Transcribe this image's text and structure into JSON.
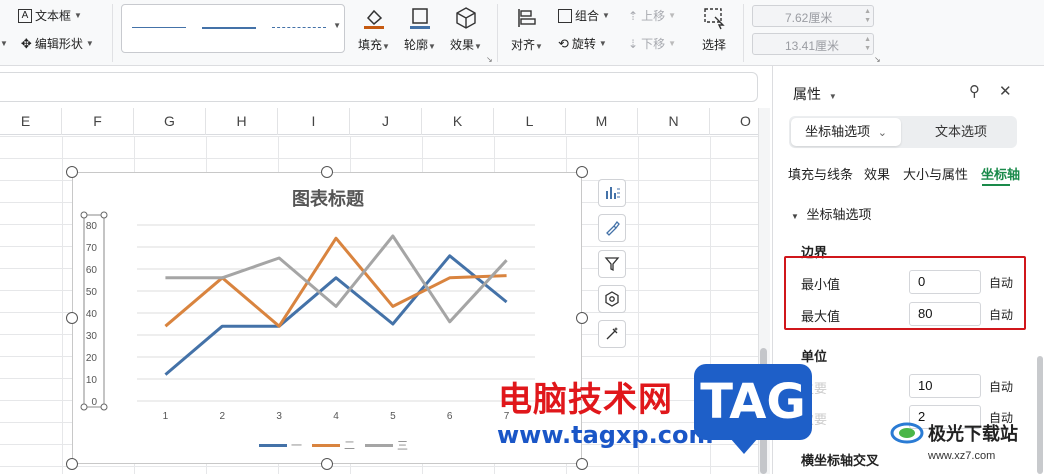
{
  "ribbon": {
    "textbox_label": "文本框",
    "edit_shape_label": "编辑形状",
    "fill_label": "填充",
    "outline_label": "轮廓",
    "effect_label": "效果",
    "align_label": "对齐",
    "group_label": "组合",
    "rotate_label": "旋转",
    "move_up_label": "上移",
    "move_down_label": "下移",
    "select_label": "选择",
    "width_value": "7.62厘米",
    "height_value": "13.41厘米"
  },
  "columns": [
    "E",
    "F",
    "G",
    "H",
    "I",
    "J",
    "K",
    "L",
    "M",
    "N",
    "O"
  ],
  "chart_data": {
    "type": "line",
    "title": "图表标题",
    "categories": [
      "1",
      "2",
      "3",
      "4",
      "5",
      "6",
      "7"
    ],
    "y_ticks": [
      "0",
      "10",
      "20",
      "30",
      "40",
      "50",
      "60",
      "70",
      "80"
    ],
    "ylim": [
      0,
      80
    ],
    "legend_position": "bottom",
    "grid": true,
    "series": [
      {
        "name": "一",
        "color": "#4472a8",
        "values": [
          12,
          34,
          34,
          56,
          35,
          66,
          45
        ]
      },
      {
        "name": "二",
        "color": "#d9843f",
        "values": [
          34,
          56,
          34,
          74,
          43,
          56,
          57
        ]
      },
      {
        "name": "三",
        "color": "#a5a5a5",
        "values": [
          56,
          56,
          65,
          43,
          75,
          36,
          64
        ]
      }
    ]
  },
  "panel": {
    "title": "属性",
    "seg_axis_options": "坐标轴选项",
    "seg_text_options": "文本选项",
    "tabs": [
      "填充与线条",
      "效果",
      "大小与属性",
      "坐标轴"
    ],
    "section_title": "坐标轴选项",
    "bounds_title": "边界",
    "min_label": "最小值",
    "min_value": "0",
    "max_label": "最大值",
    "max_value": "80",
    "auto_label": "自动",
    "units_title": "单位",
    "major_label": "主要",
    "major_value": "10",
    "minor_label": "次要",
    "minor_value": "2",
    "cross_title": "横坐标轴交叉"
  },
  "watermark": {
    "cn_text": "电脑技术网",
    "tag_text": "TAG",
    "url": "www.tagxp.com",
    "logo_text": "极光下载站",
    "logo_url": "www.xz7.com"
  }
}
